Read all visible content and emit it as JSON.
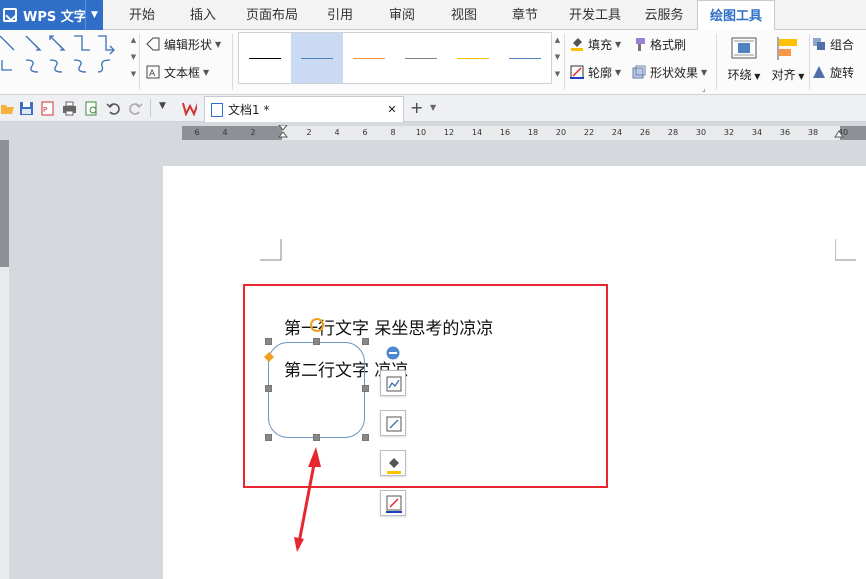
{
  "app": {
    "title": "WPS 文字"
  },
  "tabs": [
    {
      "label": "开始",
      "active": false
    },
    {
      "label": "插入",
      "active": false
    },
    {
      "label": "页面布局",
      "active": false
    },
    {
      "label": "引用",
      "active": false
    },
    {
      "label": "审阅",
      "active": false
    },
    {
      "label": "视图",
      "active": false
    },
    {
      "label": "章节",
      "active": false
    },
    {
      "label": "开发工具",
      "active": false
    },
    {
      "label": "云服务",
      "active": false
    },
    {
      "label": "绘图工具",
      "active": true
    }
  ],
  "ribbon": {
    "edit_shape": "编辑形状",
    "text_box": "文本框",
    "fill": "填充",
    "format_painter": "格式刷",
    "outline": "轮廓",
    "shape_effect": "形状效果",
    "wrap": "环绕",
    "align": "对齐",
    "group": "组合",
    "rotate": "旋转",
    "line_styles": [
      "#000000",
      "#4f81bd",
      "#f79646",
      "#808080",
      "#ffc000",
      "#4f81bd"
    ]
  },
  "document_tab": {
    "title": "文档1 *"
  },
  "ruler": {
    "numbers": [
      "6",
      "4",
      "2",
      "2",
      "4",
      "6",
      "8",
      "10",
      "12",
      "14",
      "16",
      "18",
      "20",
      "22",
      "24",
      "26",
      "28",
      "30",
      "32",
      "34",
      "36",
      "38",
      "40"
    ]
  },
  "document": {
    "line1": "第一行文字  呆坐思考的凉凉",
    "line2": "第二行文字  凉凉"
  },
  "colors": {
    "accent": "#2f6fc7",
    "highlight_box": "#e8262f",
    "arrow": "#e8262f"
  }
}
